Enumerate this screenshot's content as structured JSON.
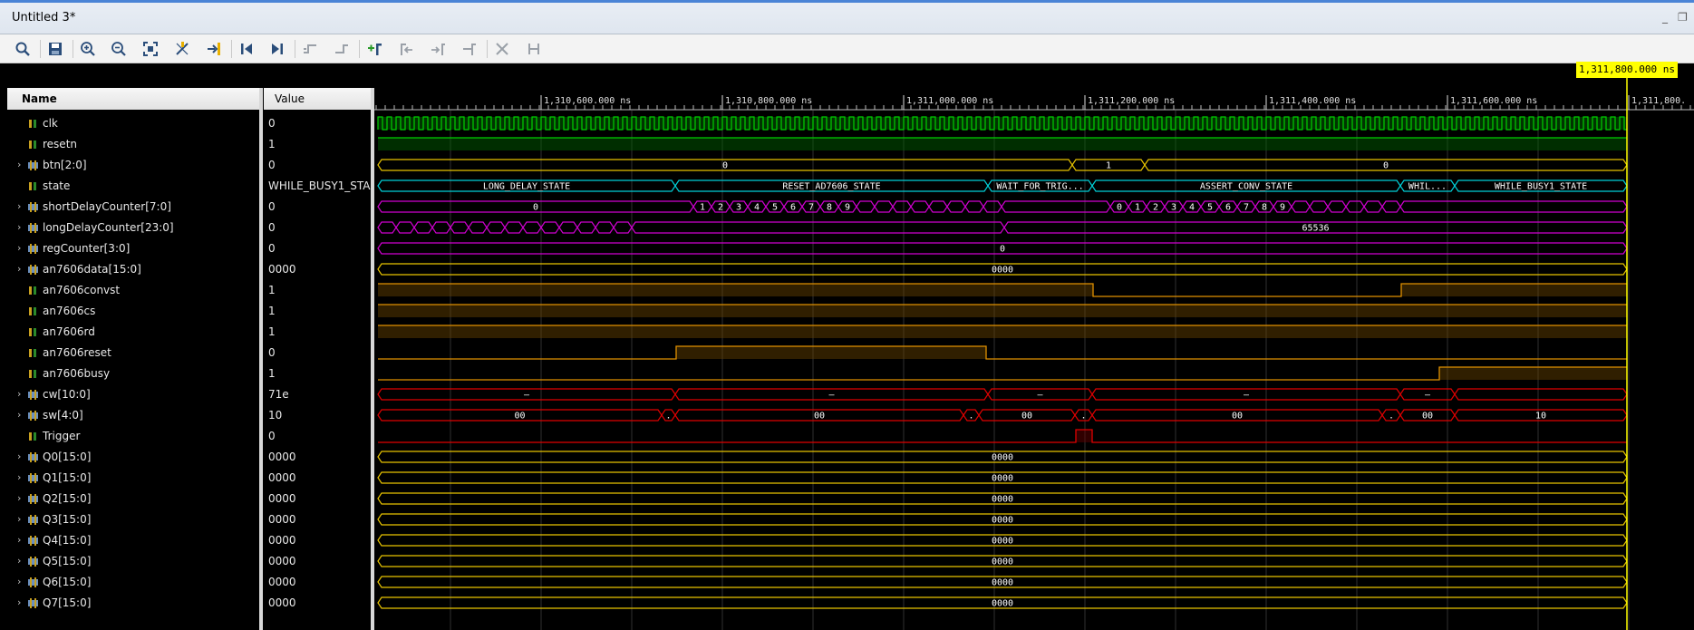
{
  "window": {
    "title": "Untitled 3*",
    "minimize_glyph": "_",
    "restore_glyph": "❐"
  },
  "toolbar": {
    "icons": [
      "search-icon",
      "save-icon",
      "zoom-in-icon",
      "zoom-out-icon",
      "zoom-fit-icon",
      "swap-cursor-icon",
      "goto-cursor-icon",
      "goto-start-icon",
      "goto-end-icon",
      "prev-transition-icon",
      "next-transition-icon",
      "add-marker-icon",
      "prev-marker-icon",
      "next-marker-icon",
      "swap-markers-icon",
      "delete-marker-icon",
      "snap-icon"
    ]
  },
  "columns": {
    "name": "Name",
    "value": "Value"
  },
  "cursor": {
    "label": "1,311,800.000 ns"
  },
  "time_axis": {
    "labels": [
      "1,310,600.000 ns",
      "1,310,800.000 ns",
      "1,311,000.000 ns",
      "1,311,200.000 ns",
      "1,311,400.000 ns",
      "1,311,600.000 ns",
      "1,311,800."
    ]
  },
  "colors": {
    "clock": "#00d000",
    "bus_yellow": "#e8c400",
    "state_cyan": "#00d0d8",
    "counter_magenta": "#d000d0",
    "bit_orange": "#e09000",
    "cw_red": "#e00000",
    "cursor": "#ffff00"
  },
  "signals": [
    {
      "name": "clk",
      "value": "0",
      "kind": "bit",
      "expandable": false
    },
    {
      "name": "resetn",
      "value": "1",
      "kind": "bit",
      "expandable": false
    },
    {
      "name": "btn[2:0]",
      "value": "0",
      "kind": "bus",
      "expandable": true
    },
    {
      "name": "state",
      "value": "WHILE_BUSY1_STA",
      "kind": "state",
      "expandable": false
    },
    {
      "name": "shortDelayCounter[7:0]",
      "value": "0",
      "kind": "bus",
      "expandable": true
    },
    {
      "name": "longDelayCounter[23:0]",
      "value": "0",
      "kind": "bus",
      "expandable": true
    },
    {
      "name": "regCounter[3:0]",
      "value": "0",
      "kind": "bus",
      "expandable": true
    },
    {
      "name": "an7606data[15:0]",
      "value": "0000",
      "kind": "bus",
      "expandable": true
    },
    {
      "name": "an7606convst",
      "value": "1",
      "kind": "bit",
      "expandable": false
    },
    {
      "name": "an7606cs",
      "value": "1",
      "kind": "bit",
      "expandable": false
    },
    {
      "name": "an7606rd",
      "value": "1",
      "kind": "bit",
      "expandable": false
    },
    {
      "name": "an7606reset",
      "value": "0",
      "kind": "bit",
      "expandable": false
    },
    {
      "name": "an7606busy",
      "value": "1",
      "kind": "bit",
      "expandable": false
    },
    {
      "name": "cw[10:0]",
      "value": "71e",
      "kind": "bus",
      "expandable": true
    },
    {
      "name": "sw[4:0]",
      "value": "10",
      "kind": "bus",
      "expandable": true
    },
    {
      "name": "Trigger",
      "value": "0",
      "kind": "bit",
      "expandable": false
    },
    {
      "name": "Q0[15:0]",
      "value": "0000",
      "kind": "bus",
      "expandable": true
    },
    {
      "name": "Q1[15:0]",
      "value": "0000",
      "kind": "bus",
      "expandable": true
    },
    {
      "name": "Q2[15:0]",
      "value": "0000",
      "kind": "bus",
      "expandable": true
    },
    {
      "name": "Q3[15:0]",
      "value": "0000",
      "kind": "bus",
      "expandable": true
    },
    {
      "name": "Q4[15:0]",
      "value": "0000",
      "kind": "bus",
      "expandable": true
    },
    {
      "name": "Q5[15:0]",
      "value": "0000",
      "kind": "bus",
      "expandable": true
    },
    {
      "name": "Q6[15:0]",
      "value": "0000",
      "kind": "bus",
      "expandable": true
    },
    {
      "name": "Q7[15:0]",
      "value": "0000",
      "kind": "bus",
      "expandable": true
    }
  ],
  "wave_labels": {
    "btn": [
      "0",
      "1",
      "0"
    ],
    "state": [
      "LONG_DELAY_STATE",
      "RESET_AD7606_STATE",
      "WAIT_FOR_TRIG...",
      "ASSERT_CONV_STATE",
      "WHIL...",
      "WHILE_BUSY1_STATE"
    ],
    "short_counter": [
      "0",
      "1",
      "2",
      "3",
      "4",
      "5",
      "6",
      "7",
      "8",
      "9",
      "0",
      "1",
      "2",
      "3",
      "4",
      "5",
      "6",
      "7",
      "8",
      "9",
      "0"
    ],
    "long_counter": [
      "65536",
      "0"
    ],
    "reg_counter": [
      "0"
    ],
    "data_value": "0000",
    "cw": [
      "—",
      "—",
      "—",
      "—",
      "—"
    ],
    "sw": [
      "00",
      "00",
      "00",
      "00",
      "00",
      "10"
    ],
    "q_value": "0000"
  }
}
